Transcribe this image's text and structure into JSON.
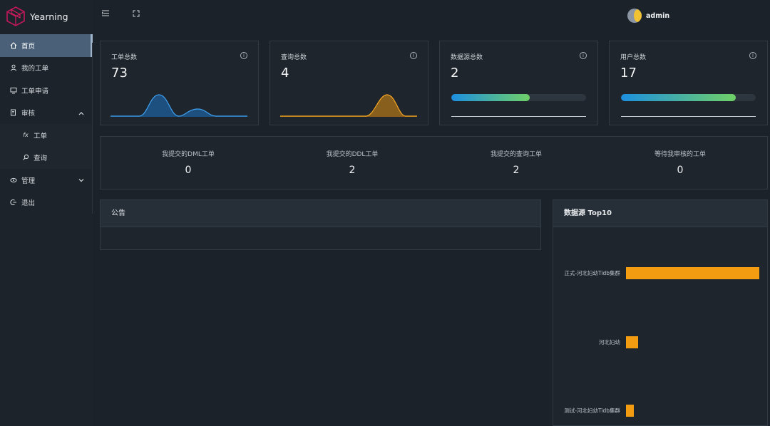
{
  "app": {
    "name": "Yearning"
  },
  "user": {
    "name": "admin"
  },
  "sidebar": {
    "items": [
      {
        "label": "首页",
        "icon": "home-icon",
        "active": true
      },
      {
        "label": "我的工单",
        "icon": "user-icon"
      },
      {
        "label": "工单申请",
        "icon": "monitor-icon"
      },
      {
        "label": "审核",
        "icon": "audit-icon",
        "expanded": true
      },
      {
        "label": "工单",
        "icon": "fx-icon",
        "sub": true
      },
      {
        "label": "查询",
        "icon": "search-icon",
        "sub": true
      },
      {
        "label": "管理",
        "icon": "settings-icon",
        "expanded": false
      },
      {
        "label": "退出",
        "icon": "logout-icon"
      }
    ]
  },
  "cards": [
    {
      "title": "工单总数",
      "value": "73",
      "visual": "spark-blue"
    },
    {
      "title": "查询总数",
      "value": "4",
      "visual": "spark-orange"
    },
    {
      "title": "数据源总数",
      "value": "2",
      "visual": "progress",
      "progress": 0.58
    },
    {
      "title": "用户总数",
      "value": "17",
      "visual": "progress",
      "progress": 0.85
    }
  ],
  "summary": [
    {
      "label": "我提交的DML工单",
      "value": "0"
    },
    {
      "label": "我提交的DDL工单",
      "value": "2"
    },
    {
      "label": "我提交的查询工单",
      "value": "2"
    },
    {
      "label": "等待我审核的工单",
      "value": "0"
    }
  ],
  "notice": {
    "title": "公告"
  },
  "top10": {
    "title": "数据源 Top10",
    "chart_data": {
      "type": "bar",
      "orientation": "horizontal",
      "categories": [
        "正式-河北妇幼Tidb集群",
        "河北妇幼",
        "测试-河北妇幼Tidb集群"
      ],
      "values": [
        100,
        9,
        6
      ],
      "color": "#f39c12"
    }
  },
  "colors": {
    "accent_orange": "#f39c12",
    "accent_blue": "#1d8fe0",
    "active_menu": "#4a6078"
  }
}
